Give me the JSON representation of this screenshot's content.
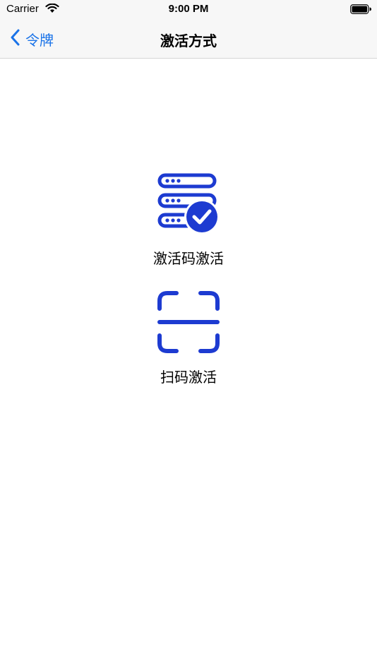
{
  "status_bar": {
    "carrier": "Carrier",
    "time": "9:00 PM"
  },
  "nav": {
    "back_label": "令牌",
    "title": "激活方式"
  },
  "options": [
    {
      "label": "激活码激活",
      "icon": "server-check-icon"
    },
    {
      "label": "扫码激活",
      "icon": "scan-icon"
    }
  ],
  "colors": {
    "accent": "#1a73e8",
    "icon_blue": "#1d3bd1"
  }
}
